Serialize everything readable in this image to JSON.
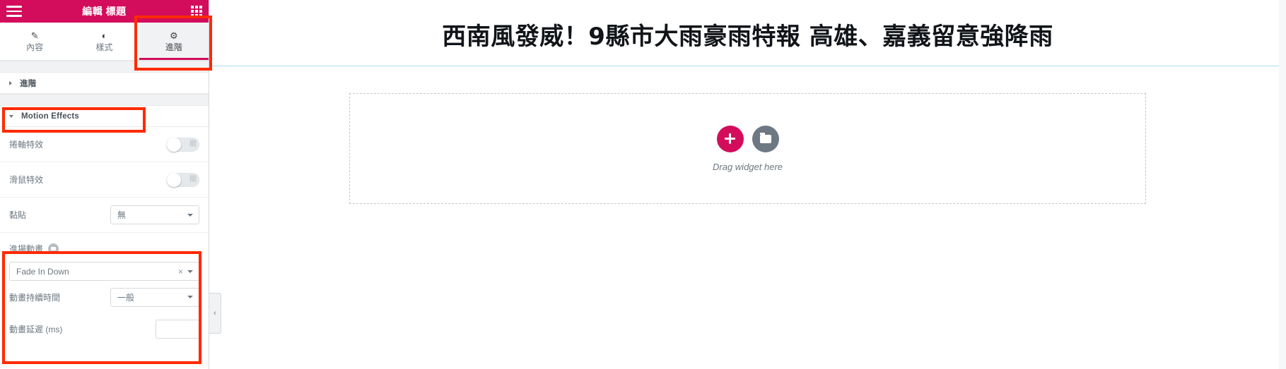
{
  "panel": {
    "title": "編輯 標題",
    "menu_icon": "hamburger-icon",
    "grid_icon": "grid-icon",
    "tabs": [
      {
        "label": "內容",
        "icon": "pencil-icon",
        "active": false
      },
      {
        "label": "樣式",
        "icon": "contrast-icon",
        "active": false
      },
      {
        "label": "進階",
        "icon": "gear-icon",
        "active": true
      }
    ],
    "sections": [
      {
        "label": "進階",
        "expanded": false
      },
      {
        "label": "Motion Effects",
        "expanded": true
      }
    ],
    "controls": {
      "scroll_effects": {
        "label": "捲軸特效",
        "state": "關"
      },
      "mouse_effects": {
        "label": "滑鼠特效",
        "state": "關"
      },
      "sticky": {
        "label": "黏貼",
        "value": "無"
      },
      "entrance_animation": {
        "label": "進場動畫",
        "value": "Fade In Down",
        "clear": "×"
      },
      "animation_duration": {
        "label": "動畫持續時間",
        "value": "一般"
      },
      "animation_delay": {
        "label": "動畫延遲 (ms)",
        "value": ""
      }
    }
  },
  "canvas": {
    "page_title": "西南風發威！9縣市大雨豪雨特報 高雄、嘉義留意強降雨",
    "dropzone": {
      "add_label": "+",
      "folder_icon": "folder-icon",
      "text": "Drag widget here"
    },
    "collapse_handle": "‹"
  },
  "colors": {
    "brand_pink": "#d30c5c",
    "highlight_red": "#ff2a00",
    "panel_gray": "#f1f2f3",
    "text_gray": "#6d7882"
  }
}
